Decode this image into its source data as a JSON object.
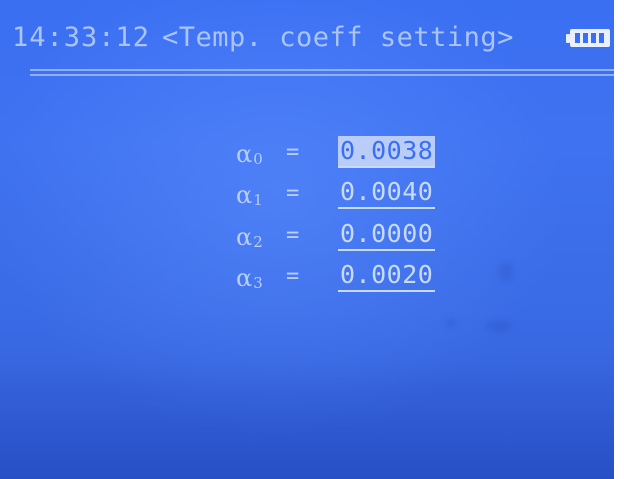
{
  "status_bar": {
    "time": "14:33:12",
    "title": "<Temp. coeff setting>",
    "battery_icon": "battery-full-icon",
    "battery_level": 1.0
  },
  "coefficients": [
    {
      "symbol": "α",
      "index": "0",
      "equals": "=",
      "value": "0.0038",
      "selected": true
    },
    {
      "symbol": "α",
      "index": "1",
      "equals": "=",
      "value": "0.0040",
      "selected": false
    },
    {
      "symbol": "α",
      "index": "2",
      "equals": "=",
      "value": "0.0000",
      "selected": false
    },
    {
      "symbol": "α",
      "index": "3",
      "equals": "=",
      "value": "0.0020",
      "selected": false
    }
  ],
  "colors": {
    "screen_background": "#3a6ff2",
    "text": "#a9c4ff",
    "selected_highlight": "#b9cdf8"
  }
}
